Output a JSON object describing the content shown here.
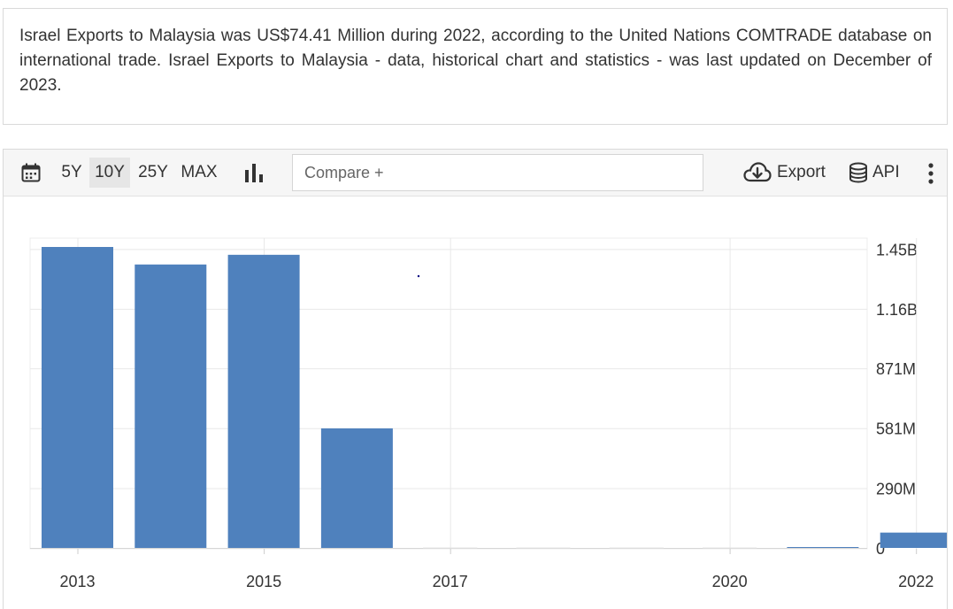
{
  "description": {
    "text": "Israel Exports to Malaysia was US$74.41 Million during 2022, according to the United Nations COMTRADE database on international trade. Israel Exports to Malaysia - data, historical chart and statistics - was last updated on December of 2023."
  },
  "toolbar": {
    "calendar_icon": "calendar-icon",
    "ranges": [
      {
        "label": "5Y",
        "active": false
      },
      {
        "label": "10Y",
        "active": true
      },
      {
        "label": "25Y",
        "active": false
      },
      {
        "label": "MAX",
        "active": false
      }
    ],
    "chart_type_icon": "bar-chart-icon",
    "compare_placeholder": "Compare +",
    "export_label": "Export",
    "export_icon": "cloud-download-icon",
    "api_label": "API",
    "api_icon": "database-icon",
    "more_icon": "more-vertical-icon"
  },
  "colors": {
    "bar": "#4f81bd",
    "grid": "#e8e8e8",
    "marker": "#000080"
  },
  "chart_data": {
    "type": "bar",
    "x": [
      2013,
      2014,
      2015,
      2016,
      2017,
      2018,
      2019,
      2020,
      2021,
      2022
    ],
    "values": [
      1460,
      1375,
      1422,
      580,
      0,
      0,
      0,
      0,
      3,
      74.41
    ],
    "value_unit": "US$ Million",
    "x_tick_labels": [
      "2013",
      "2015",
      "2017",
      "2020",
      "2022"
    ],
    "x_tick_values": [
      2013,
      2015,
      2017,
      2020,
      2022
    ],
    "y_tick_labels": [
      "0",
      "290M",
      "581M",
      "871M",
      "1.16B",
      "1.45B"
    ],
    "y_tick_values": [
      0,
      290,
      581,
      871,
      1160,
      1450
    ],
    "ylim": [
      0,
      1510
    ],
    "y_axis_side": "right",
    "grid": true,
    "legend": "none",
    "title": "",
    "xlabel": "",
    "ylabel": ""
  }
}
